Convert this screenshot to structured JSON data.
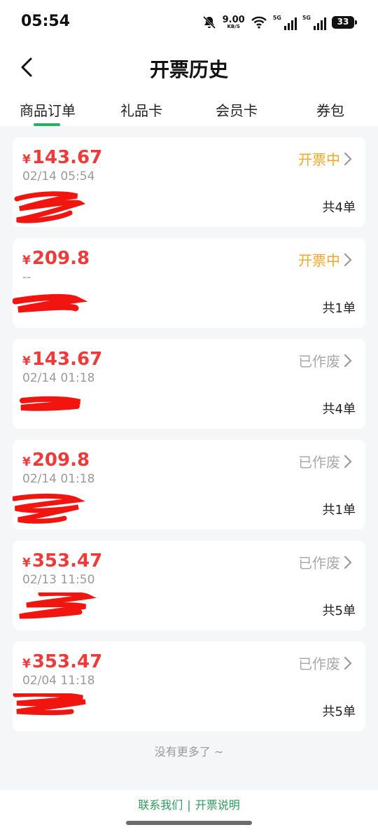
{
  "status_bar": {
    "time": "05:54",
    "net_speed": "9.00",
    "net_unit": "KB/S",
    "sig1": "5G",
    "sig2": "5G",
    "battery": "33"
  },
  "header": {
    "title": "开票历史"
  },
  "tabs": [
    {
      "label": "商品订单",
      "active": true
    },
    {
      "label": "礼品卡"
    },
    {
      "label": "会员卡"
    },
    {
      "label": "券包"
    }
  ],
  "currency": "¥",
  "orders": [
    {
      "amount": "143.67",
      "date": "02/14 05:54",
      "status": "开票中",
      "count": "共4单"
    },
    {
      "amount": "209.8",
      "date": "--",
      "status": "开票中",
      "count": "共1单"
    },
    {
      "amount": "143.67",
      "date": "02/14 01:18",
      "status": "已作废",
      "count": "共4单"
    },
    {
      "amount": "209.8",
      "date": "02/14 01:18",
      "status": "已作废",
      "count": "共1单"
    },
    {
      "amount": "353.47",
      "date": "02/13 11:50",
      "status": "已作废",
      "count": "共5单"
    },
    {
      "amount": "353.47",
      "date": "02/04 11:18",
      "status": "已作废",
      "count": "共5单"
    }
  ],
  "no_more_text": "没有更多了 ~",
  "footer": {
    "contact": "联系我们",
    "separator": "|",
    "explain": "开票说明"
  },
  "colors": {
    "accent_green": "#22b35e",
    "price_red": "#f03a3a",
    "status_pending": "#f6a623",
    "status_void": "#a9a9a9"
  }
}
